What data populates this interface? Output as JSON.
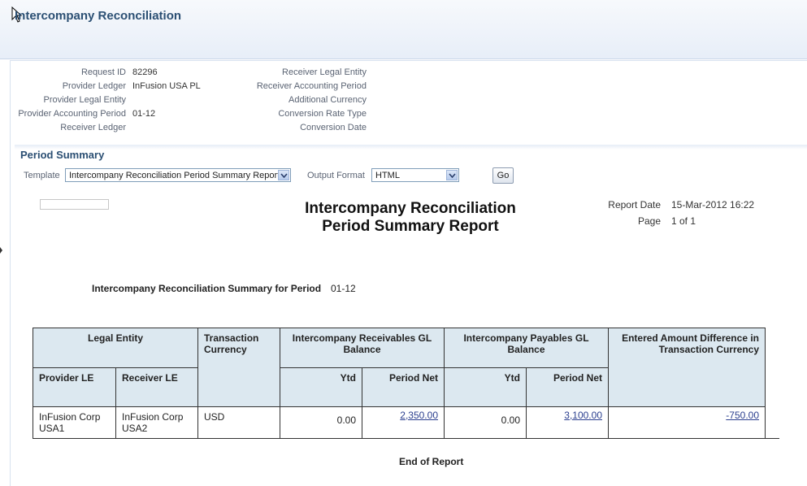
{
  "page": {
    "title": "Intercompany Reconciliation"
  },
  "info": {
    "left": [
      {
        "label": "Request ID",
        "value": "82296"
      },
      {
        "label": "Provider Ledger",
        "value": "InFusion USA PL"
      },
      {
        "label": "Provider Legal Entity",
        "value": ""
      },
      {
        "label": "Provider Accounting Period",
        "value": "01-12"
      },
      {
        "label": "Receiver Ledger",
        "value": ""
      }
    ],
    "right": [
      {
        "label": "Receiver Legal Entity",
        "value": ""
      },
      {
        "label": "Receiver Accounting Period",
        "value": ""
      },
      {
        "label": "Additional Currency",
        "value": ""
      },
      {
        "label": "Conversion Rate Type",
        "value": ""
      },
      {
        "label": "Conversion Date",
        "value": ""
      }
    ]
  },
  "period_summary": {
    "title": "Period Summary",
    "template_label": "Template",
    "template_value": "Intercompany Reconciliation Period Summary Report",
    "output_label": "Output Format",
    "output_value": "HTML",
    "go_label": "Go"
  },
  "report": {
    "title_line1": "Intercompany Reconciliation",
    "title_line2": "Period Summary Report",
    "date_label": "Report Date",
    "date_value": "15-Mar-2012 16:22",
    "page_label": "Page",
    "page_value": "1 of 1",
    "summary_label": "Intercompany Reconciliation Summary for Period",
    "summary_value": "01-12",
    "end_label": "End of Report"
  },
  "table": {
    "h_legal_entity": "Legal Entity",
    "h_txn_currency": "Transaction Currency",
    "h_receivables": "Intercompany Receivables GL Balance",
    "h_payables": "Intercompany Payables GL Balance",
    "h_difference": "Entered Amount Difference in Transaction Currency",
    "h_provider_le": "Provider LE",
    "h_receiver_le": "Receiver LE",
    "h_rec_ytd": "Ytd",
    "h_rec_period_net": "Period Net",
    "h_pay_ytd": "Ytd",
    "h_pay_period_net": "Period Net",
    "row": {
      "provider_le": "InFusion Corp USA1",
      "receiver_le": "InFusion Corp USA2",
      "currency": "USD",
      "rec_ytd": "0.00",
      "rec_period_net": "2,350.00",
      "pay_ytd": "0.00",
      "pay_period_net": "3,100.00",
      "difference": "-750.00"
    }
  }
}
